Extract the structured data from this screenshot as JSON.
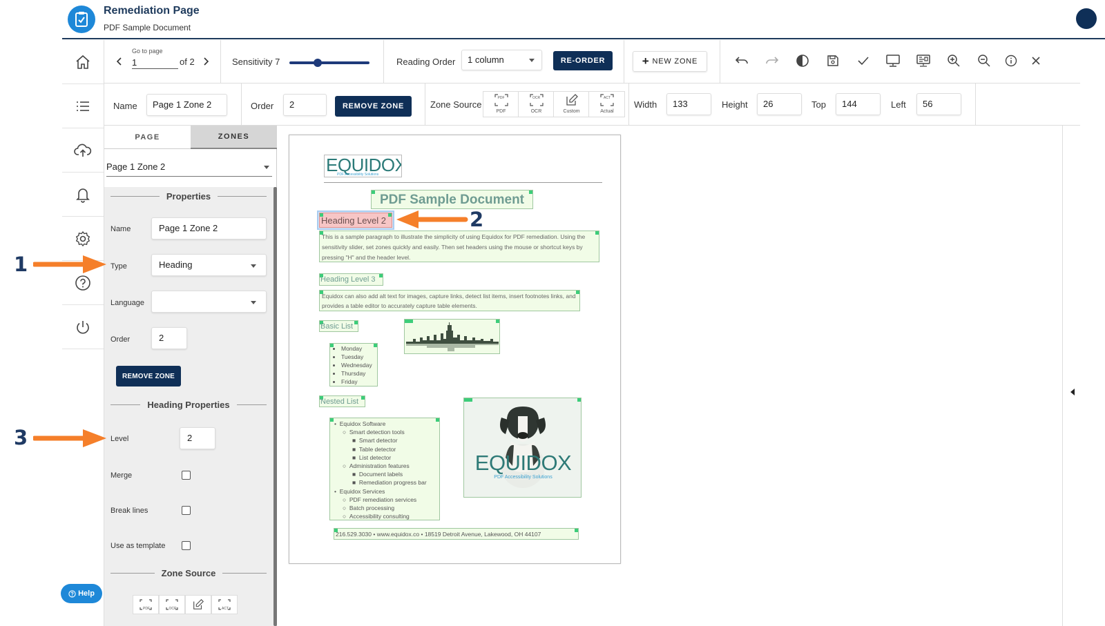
{
  "header": {
    "title": "Remediation Page",
    "subtitle": "PDF Sample Document"
  },
  "sidebar": {
    "items": [
      {
        "name": "home",
        "icon": "home-icon"
      },
      {
        "name": "list",
        "icon": "list-icon"
      },
      {
        "name": "upload",
        "icon": "cloud-upload-icon"
      },
      {
        "name": "notifications",
        "icon": "bell-icon"
      },
      {
        "name": "settings",
        "icon": "gear-icon"
      },
      {
        "name": "help",
        "icon": "help-circle-icon"
      },
      {
        "name": "logout",
        "icon": "power-icon"
      }
    ],
    "help_label": "Help"
  },
  "toolbar": {
    "go_to_page_label": "Go to page",
    "page_value": "1",
    "page_of": "of 2",
    "sensitivity_label": "Sensitivity 7",
    "sensitivity_value": 7,
    "reading_order_label": "Reading Order",
    "reading_order_value": "1 column",
    "reorder_label": "RE-ORDER",
    "new_zone_label": "NEW ZONE"
  },
  "zone_bar": {
    "name_label": "Name",
    "name_value": "Page 1 Zone 2",
    "order_label": "Order",
    "order_value": "2",
    "remove_zone_label": "REMOVE ZONE",
    "zone_source_label": "Zone Source",
    "sources": [
      {
        "tag": "PDF",
        "label": "PDF"
      },
      {
        "tag": "OCR",
        "label": "OCR"
      },
      {
        "tag": "",
        "label": "Custom"
      },
      {
        "tag": "ACT",
        "label": "Actual"
      }
    ],
    "width_label": "Width",
    "width_value": "133",
    "height_label": "Height",
    "height_value": "26",
    "top_label": "Top",
    "top_value": "144",
    "left_label": "Left",
    "left_value": "56"
  },
  "panel": {
    "tab_page": "PAGE",
    "tab_zones": "ZONES",
    "zone_select": "Page 1 Zone 2",
    "properties_header": "Properties",
    "name_label": "Name",
    "name_value": "Page 1 Zone 2",
    "type_label": "Type",
    "type_value": "Heading",
    "language_label": "Language",
    "language_value": "",
    "order_label": "Order",
    "order_value": "2",
    "remove_zone_label": "REMOVE ZONE",
    "heading_props_header": "Heading Properties",
    "level_label": "Level",
    "level_value": "2",
    "merge_label": "Merge",
    "break_lines_label": "Break lines",
    "use_template_label": "Use as template",
    "zone_source_header": "Zone Source",
    "source_tags": [
      "PDF",
      "OCR",
      "",
      "ACT"
    ]
  },
  "document": {
    "logo_text": "EQUIDOX",
    "logo_tagline": "PDF Accessibility Solutions",
    "title": "PDF Sample Document",
    "heading2": "Heading Level 2",
    "para1": "This is a sample paragraph to illustrate the simplicity of using Equidox for PDF remediation. Using the sensitivity slider, set zones quickly and easily. Then set headers using the mouse or shortcut keys by pressing \"H\" and the header level.",
    "heading3": "Heading Level 3",
    "para2": "Equidox can also add alt text for images, capture links, detect list items, insert footnotes links, and provides a table editor to accurately capture table elements.",
    "basic_list_heading": "Basic List",
    "days": [
      "Monday",
      "Tuesday",
      "Wednesday",
      "Thursday",
      "Friday"
    ],
    "nested_list_heading": "Nested List",
    "nested": [
      {
        "level": 1,
        "text": "Equidox Software"
      },
      {
        "level": 2,
        "text": "Smart detection tools"
      },
      {
        "level": 3,
        "text": "Smart detector"
      },
      {
        "level": 3,
        "text": "Table detector"
      },
      {
        "level": 3,
        "text": "List detector"
      },
      {
        "level": 2,
        "text": "Administration features"
      },
      {
        "level": 3,
        "text": "Document labels"
      },
      {
        "level": 3,
        "text": "Remediation progress bar"
      },
      {
        "level": 1,
        "text": "Equidox Services"
      },
      {
        "level": 2,
        "text": "PDF remediation services"
      },
      {
        "level": 2,
        "text": "Batch processing"
      },
      {
        "level": 2,
        "text": "Accessibility consulting"
      }
    ],
    "dog_logo_text": "EQUIDOX",
    "dog_logo_tagline": "PDF Accessibility Solutions",
    "footer": "216.529.3030 • www.equidox.co • 18519 Detroit Avenue, Lakewood, OH 44107"
  },
  "annotations": [
    "1",
    "2",
    "3"
  ],
  "colors": {
    "navy": "#0f2f57",
    "accent_blue": "#1e88d8",
    "arrow_orange": "#f57f2a",
    "zone_green": "#3ccd7a",
    "selected_zone": "#f7c6c6"
  }
}
